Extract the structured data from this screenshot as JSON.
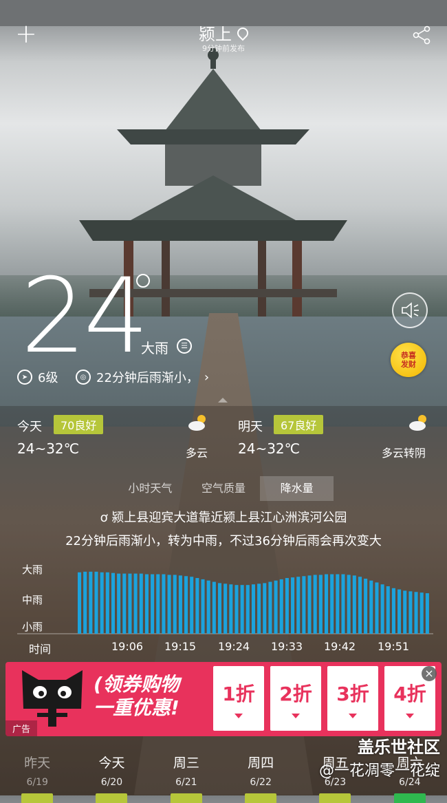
{
  "header": {
    "city": "颍上",
    "published": "9分钟前发布"
  },
  "current": {
    "temperature": "24",
    "condition": "大雨",
    "wind": "6级",
    "rain_notice": "22分钟后雨渐小，"
  },
  "fortune_badge": {
    "line1": "恭喜",
    "line2": "发财"
  },
  "today": {
    "label": "今天",
    "aqi": "70良好",
    "range": "24~32℃",
    "condition": "多云"
  },
  "tomorrow": {
    "label": "明天",
    "aqi": "67良好",
    "range": "24~32℃",
    "condition": "多云转阴"
  },
  "tabs": [
    {
      "label": "小时天气",
      "active": false
    },
    {
      "label": "空气质量",
      "active": false
    },
    {
      "label": "降水量",
      "active": true
    }
  ],
  "precip": {
    "location": "颍上县迎宾大道靠近颍上县江心洲滨河公园",
    "forecast": "22分钟后雨渐小，转为中雨，不过36分钟后雨会再次变大",
    "y_labels": [
      "大雨",
      "中雨",
      "小雨"
    ],
    "x_axis_label": "时间",
    "x_ticks": [
      "19:06",
      "19:15",
      "19:24",
      "19:33",
      "19:42",
      "19:51"
    ]
  },
  "chart_data": {
    "type": "bar",
    "x_ticks": [
      "19:06",
      "19:15",
      "19:24",
      "19:33",
      "19:42",
      "19:51"
    ],
    "y_levels": [
      "小雨",
      "中雨",
      "大雨"
    ],
    "ylim": [
      0,
      1
    ],
    "values": [
      0.97,
      0.98,
      0.98,
      0.98,
      0.97,
      0.97,
      0.96,
      0.95,
      0.95,
      0.95,
      0.95,
      0.95,
      0.94,
      0.94,
      0.94,
      0.94,
      0.93,
      0.93,
      0.92,
      0.91,
      0.9,
      0.88,
      0.86,
      0.84,
      0.82,
      0.8,
      0.79,
      0.78,
      0.77,
      0.77,
      0.77,
      0.78,
      0.79,
      0.8,
      0.82,
      0.84,
      0.86,
      0.88,
      0.89,
      0.9,
      0.91,
      0.92,
      0.93,
      0.93,
      0.94,
      0.94,
      0.94,
      0.94,
      0.93,
      0.92,
      0.9,
      0.87,
      0.84,
      0.81,
      0.78,
      0.75,
      0.72,
      0.7,
      0.68,
      0.67,
      0.66,
      0.65,
      0.64
    ]
  },
  "ad": {
    "slogan_line1": "(领券购物",
    "slogan_line2": "一重优惠!",
    "offers": [
      "1折",
      "2折",
      "3折",
      "4折"
    ],
    "tag": "广告"
  },
  "week": [
    {
      "name": "昨天",
      "date": "6/19",
      "past": true
    },
    {
      "name": "今天",
      "date": "6/20",
      "past": false
    },
    {
      "name": "周三",
      "date": "6/21",
      "past": false
    },
    {
      "name": "周四",
      "date": "6/22",
      "past": false
    },
    {
      "name": "周五",
      "date": "6/23",
      "past": false
    },
    {
      "name": "周六",
      "date": "6/24",
      "past": false
    }
  ],
  "watermark": {
    "line1": "盖乐世社区",
    "line2": "@一花凋零一花绽"
  },
  "colors": {
    "aqi_good": "#b6c63a",
    "bar": "#1ba3dd",
    "ad_bg": "#e8325c"
  }
}
